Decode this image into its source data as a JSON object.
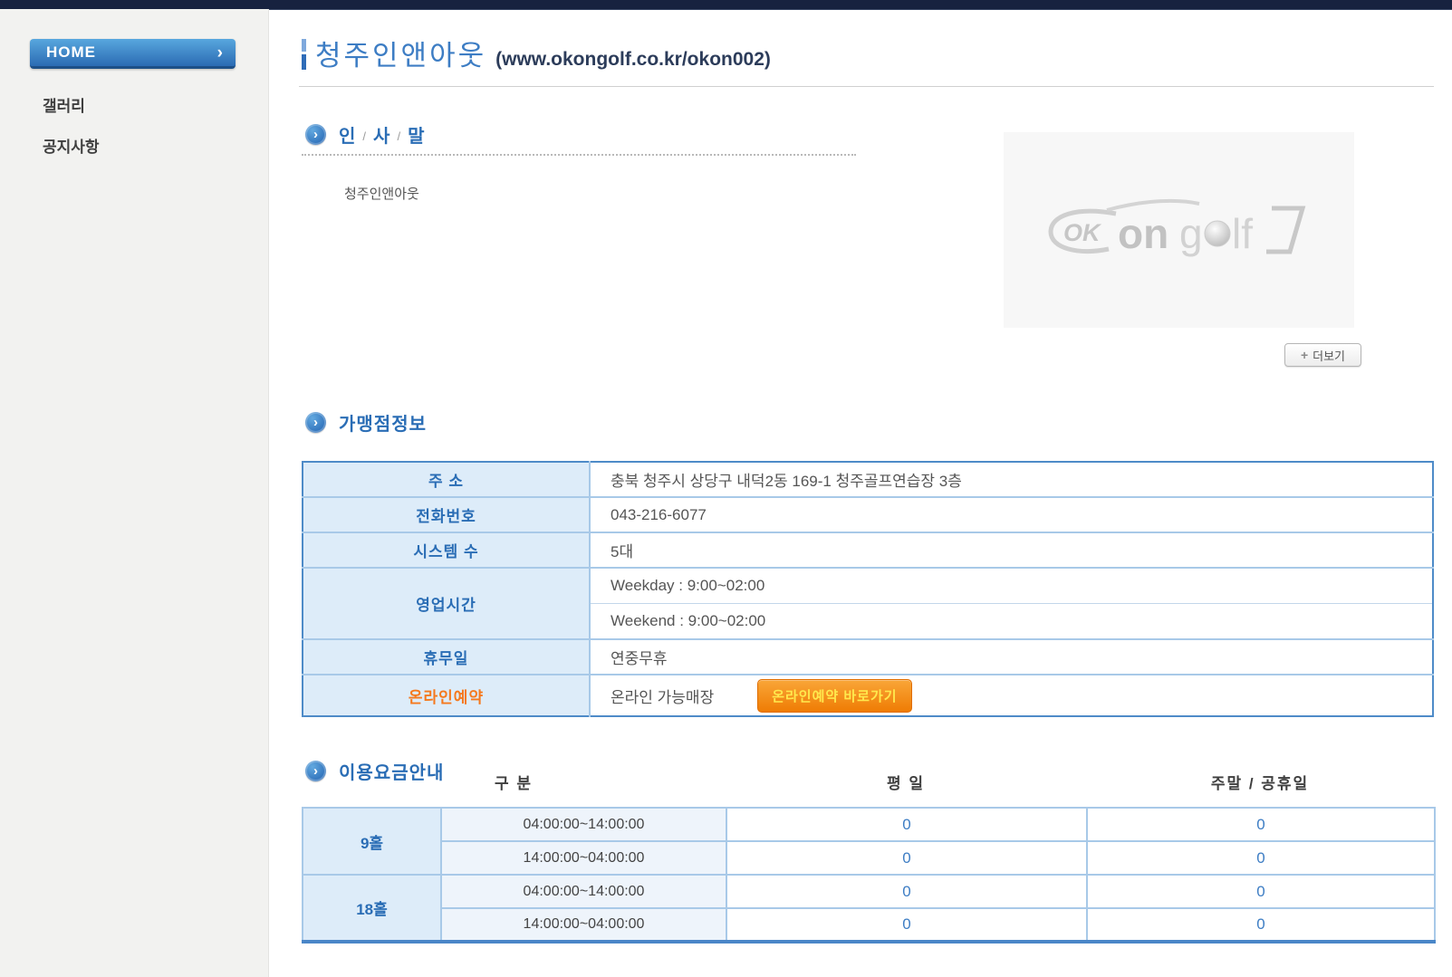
{
  "sidebar": {
    "home": {
      "label": "HOME",
      "arrow": "›"
    },
    "items": [
      {
        "label": "갤러리"
      },
      {
        "label": "공지사항"
      }
    ]
  },
  "header": {
    "title": "청주인앤아웃",
    "url": "(www.okongolf.co.kr/okon002)"
  },
  "icons": {
    "section_arrow": "›",
    "plus": "+"
  },
  "greeting": {
    "heading_parts": [
      "인",
      "/",
      "사",
      "/",
      "말"
    ],
    "body": "청주인앤아웃",
    "more_label": "더보기",
    "logo": {
      "ok": "OK",
      "on": "on",
      "g": "g",
      "lf": "lf"
    }
  },
  "franchise": {
    "heading": "가맹점정보",
    "rows": {
      "address": {
        "label": "주 소",
        "value": "충북 청주시 상당구 내덕2동 169-1 청주골프연습장 3층"
      },
      "phone": {
        "label": "전화번호",
        "value": "043-216-6077"
      },
      "systems": {
        "label": "시스템 수",
        "value": "5대"
      },
      "hours": {
        "label": "영업시간",
        "weekday": "Weekday : 9:00~02:00",
        "weekend": "Weekend : 9:00~02:00"
      },
      "closed": {
        "label": "휴무일",
        "value": "연중무휴"
      },
      "reservation": {
        "label": "온라인예약",
        "value": "온라인 가능매장",
        "button": "온라인예약 바로가기"
      }
    }
  },
  "fees": {
    "heading": "이용요금안내",
    "columns": {
      "group": "구 분",
      "weekday": "평 일",
      "weekend": "주말 / 공휴일"
    },
    "groups": [
      {
        "name": "9홀",
        "rows": [
          {
            "time": "04:00:00~14:00:00",
            "weekday": "0",
            "weekend": "0"
          },
          {
            "time": "14:00:00~04:00:00",
            "weekday": "0",
            "weekend": "0"
          }
        ]
      },
      {
        "name": "18홀",
        "rows": [
          {
            "time": "04:00:00~14:00:00",
            "weekday": "0",
            "weekend": "0"
          },
          {
            "time": "14:00:00~04:00:00",
            "weekday": "0",
            "weekend": "0"
          }
        ]
      }
    ]
  },
  "colors": {
    "topbar_navy": "#17223f",
    "accent_blue": "#2a6db5",
    "title_blue": "#3d7dc4",
    "table_border": "#4e8bc8",
    "label_bg": "#ddecf9",
    "orange_label": "#f5791d",
    "button_orange": "#ef7c04",
    "button_text": "#ffe84d",
    "sidebar_bg": "#f2f2f0"
  }
}
